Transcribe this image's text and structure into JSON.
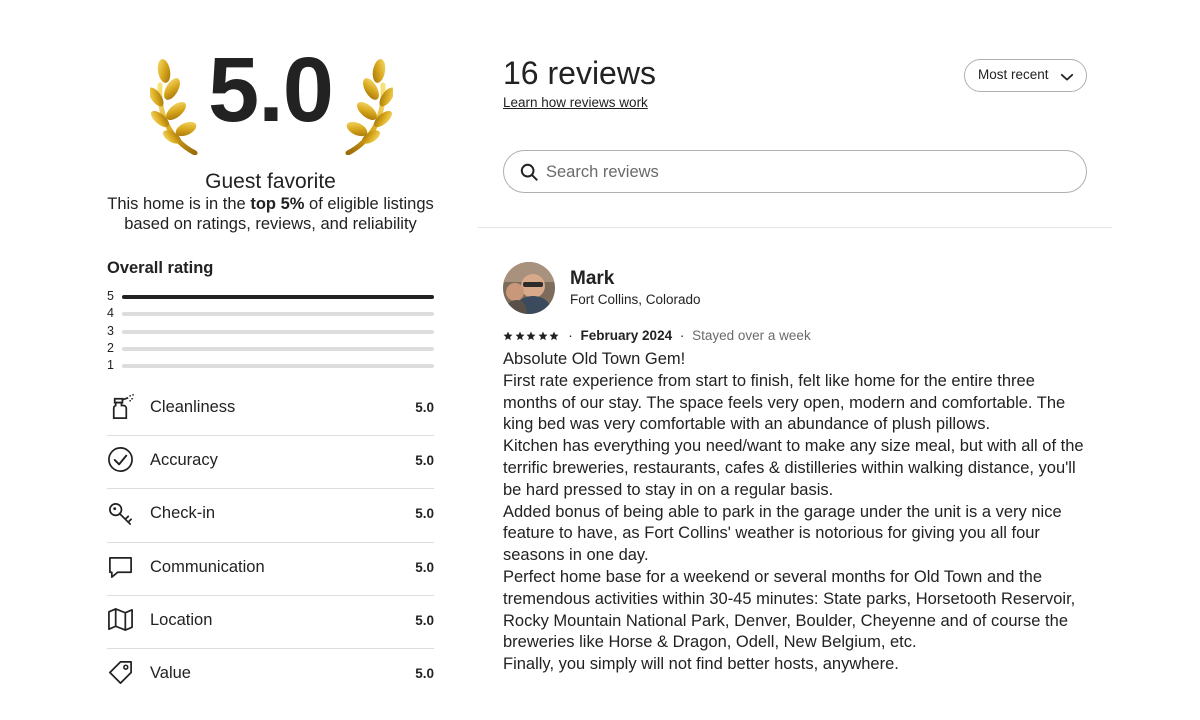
{
  "summary": {
    "rating": "5.0",
    "badge_title": "Guest favorite",
    "desc_prefix": "This home is in the",
    "desc_bold": "top 5%",
    "desc_suffix": "of eligible listings based on ratings, reviews, and reliability",
    "overall_label": "Overall rating",
    "distribution": [
      {
        "stars": "5",
        "fraction": 1.0
      },
      {
        "stars": "4",
        "fraction": 0.0
      },
      {
        "stars": "3",
        "fraction": 0.0
      },
      {
        "stars": "2",
        "fraction": 0.0
      },
      {
        "stars": "1",
        "fraction": 0.0
      }
    ],
    "categories": [
      {
        "label": "Cleanliness",
        "value": "5.0",
        "icon": "spray-bottle-icon"
      },
      {
        "label": "Accuracy",
        "value": "5.0",
        "icon": "check-circle-icon"
      },
      {
        "label": "Check-in",
        "value": "5.0",
        "icon": "key-icon"
      },
      {
        "label": "Communication",
        "value": "5.0",
        "icon": "chat-bubble-icon"
      },
      {
        "label": "Location",
        "value": "5.0",
        "icon": "map-icon"
      },
      {
        "label": "Value",
        "value": "5.0",
        "icon": "price-tag-icon"
      }
    ]
  },
  "reviews_header": {
    "count_label": "16 reviews",
    "learn_link": "Learn how reviews work",
    "sort_label": "Most recent",
    "search_placeholder": "Search reviews"
  },
  "review": {
    "name": "Mark",
    "location": "Fort Collins, Colorado",
    "stars": 5,
    "date": "February 2024",
    "stay": "Stayed over a week",
    "text": "Absolute Old Town Gem!\nFirst rate experience from start to finish, felt like home for the entire three months of our stay. The space feels very open, modern and comfortable. The king bed was very comfortable with an abundance of plush pillows.\nKitchen has everything you need/want to make any size meal, but with all of the terrific breweries, restaurants, cafes & distilleries within walking distance, you'll be hard pressed to stay in on a regular basis.\nAdded bonus of being able to park in the garage under the unit is a very nice feature to have, as Fort Collins' weather is notorious for giving you all four seasons in one day.\nPerfect home base for a weekend or several months for Old Town and the tremendous activities within 30-45 minutes: State parks, Horsetooth Reservoir, Rocky Mountain National Park, Denver, Boulder, Cheyenne and of course the breweries like Horse & Dragon, Odell, New Belgium, etc.\nFinally, you simply will not find better hosts, anywhere."
  }
}
